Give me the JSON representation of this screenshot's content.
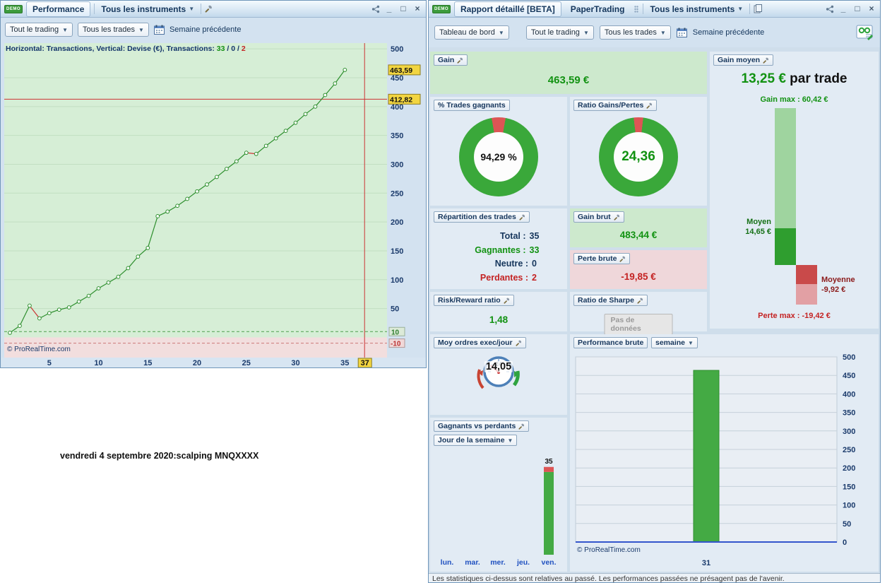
{
  "perf_window": {
    "titlebar": {
      "demo": "DEMO",
      "tab": "Performance",
      "instruments": "Tous les instruments"
    },
    "toolbar": {
      "trading": "Tout le trading",
      "trades": "Tous les trades",
      "period": "Semaine précédente"
    },
    "chart": {
      "info": {
        "prefix": "Horizontal: Transactions, Vertical: Devise (€), Transactions: ",
        "wins": "33",
        "sep1": " / ",
        "neutral": "0",
        "sep2": " / ",
        "losses": "2"
      },
      "copyright": "© ProRealTime.com"
    }
  },
  "caption": "vendredi 4 septembre 2020:scalping MNQXXXX",
  "report_window": {
    "titlebar": {
      "demo": "DEMO",
      "tab_report": "Rapport détaillé [BETA]",
      "tab_paper": "PaperTrading",
      "instruments": "Tous les instruments"
    },
    "toolbar": {
      "dashboard": "Tableau de bord",
      "trading": "Tout le trading",
      "trades": "Tous les trades",
      "period": "Semaine précédente"
    },
    "panels": {
      "gain": {
        "title": "Gain",
        "value": "463,59 €"
      },
      "gain_moyen": {
        "title": "Gain moyen",
        "value": "13,25 €",
        "suffix": " par trade",
        "gain_max": "Gain max : 60,42 €",
        "moyen_label": "Moyen",
        "moyen_value": "14,65 €",
        "moyenne_label": "Moyenne",
        "moyenne_value": "-9,92 €",
        "perte_max": "Perte max : -19,42 €"
      },
      "pct_gagnants": {
        "title": "% Trades gagnants",
        "value": "94,29 %",
        "green_pct": 94.29
      },
      "ratio_gp": {
        "title": "Ratio Gains/Pertes",
        "value": "24,36",
        "green_pct": 96.1
      },
      "repartition": {
        "title": "Répartition des trades",
        "total_label": "Total :",
        "total": "35",
        "win_label": "Gagnantes :",
        "wins": "33",
        "neutral_label": "Neutre :",
        "neutral": "0",
        "loss_label": "Perdantes :",
        "losses": "2"
      },
      "gain_brut": {
        "title": "Gain brut",
        "value": "483,44 €"
      },
      "perte_brute": {
        "title": "Perte brute",
        "value": "-19,85 €"
      },
      "risk_reward": {
        "title": "Risk/Reward ratio",
        "value": "1,48"
      },
      "sharpe": {
        "title": "Ratio de Sharpe",
        "value": "Pas de données"
      },
      "moy_ordres": {
        "title": "Moy ordres exec/jour",
        "value": "14,05",
        "gauge_label": "24"
      },
      "gagnants_perdants": {
        "title": "Gagnants vs perdants",
        "dropdown": "Jour de la semaine"
      },
      "perf_brute": {
        "title": "Performance brute",
        "dropdown": "semaine"
      }
    },
    "copyright": "© ProRealTime.com",
    "footer": "Les statistiques ci-dessus sont relatives au passé. Les performances passées ne présagent pas de l'avenir."
  },
  "colors": {
    "axis_text": "#1a3a6b",
    "line_green": "#2e8f2e",
    "line_red": "#cc3333",
    "chart_green_bg": "#d6eed6",
    "chart_pink_bg": "#f2dede",
    "grid_green": "#c2dfc2",
    "yellow_label": "#f2d541",
    "donut_green": "#3aa83a",
    "donut_red": "#dd5555",
    "bar_green": "#44aa44",
    "bar_red": "#dd5555",
    "day_label_blue": "#2051c0",
    "baseline_blue": "#3355cc",
    "gm_light_green": "#9fd49f",
    "gm_dark_green": "#2f9e2f",
    "gm_dark_red": "#c94a4a",
    "gm_light_red": "#e2a0a4"
  },
  "chart_data": [
    {
      "id": "equity_curve",
      "type": "line",
      "title": "Performance",
      "xlabel": "Transactions",
      "ylabel": "Devise (€)",
      "x": [
        1,
        2,
        3,
        4,
        5,
        6,
        7,
        8,
        9,
        10,
        11,
        12,
        13,
        14,
        15,
        16,
        17,
        18,
        19,
        20,
        21,
        22,
        23,
        24,
        25,
        26,
        27,
        28,
        29,
        30,
        31,
        32,
        33,
        34,
        35
      ],
      "y": [
        8,
        20,
        55,
        33,
        42,
        48,
        52,
        62,
        72,
        85,
        95,
        105,
        120,
        140,
        155,
        210,
        218,
        228,
        240,
        253,
        265,
        278,
        292,
        305,
        320,
        318,
        332,
        345,
        358,
        372,
        387,
        400,
        420,
        440,
        463.59
      ],
      "yticks": [
        500,
        450,
        400,
        350,
        300,
        250,
        200,
        150,
        100,
        50
      ],
      "xticks": [
        5,
        10,
        15,
        20,
        25,
        30,
        35
      ],
      "ylim": [
        -35,
        510
      ],
      "xlim": [
        0,
        38
      ],
      "grid": true,
      "hline": 412.82,
      "hline_label": "412,82",
      "vline": 37,
      "last_value": 463.59,
      "last_value_label": "463,59",
      "bands": {
        "upper": 10,
        "lower": -10,
        "upper_label": "10",
        "lower_label": "-10"
      },
      "cursor_x_label": "37"
    },
    {
      "id": "weekly_performance",
      "type": "bar",
      "title": "Performance brute (semaine)",
      "categories": [
        "31"
      ],
      "values": [
        463.59
      ],
      "yticks": [
        500,
        450,
        400,
        350,
        300,
        250,
        200,
        150,
        100,
        50,
        0
      ],
      "ylim": [
        0,
        500
      ],
      "grid": true,
      "legend": "none"
    },
    {
      "id": "day_of_week",
      "type": "bar",
      "title": "Gagnants vs perdants (Jour de la semaine)",
      "categories": [
        "lun.",
        "mar.",
        "mer.",
        "jeu.",
        "ven."
      ],
      "series": [
        {
          "name": "gagnants",
          "values": [
            0,
            0,
            0,
            0,
            33
          ]
        },
        {
          "name": "perdants",
          "values": [
            0,
            0,
            0,
            0,
            2
          ]
        }
      ],
      "total_labels": [
        "",
        "",
        "",
        "",
        "35"
      ]
    }
  ]
}
